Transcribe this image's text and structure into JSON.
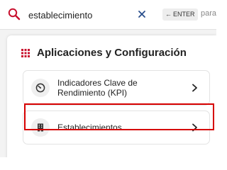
{
  "search": {
    "value": "establecimiento",
    "enter_label": "ENTER",
    "enter_arrow": "←",
    "hint_suffix": "para"
  },
  "section": {
    "title": "Aplicaciones y Configuración"
  },
  "items": [
    {
      "label": "Indicadores Clave de Rendimiento (KPI)",
      "icon": "gauge-icon"
    },
    {
      "label": "Establecimientos",
      "icon": "building-icon"
    }
  ],
  "colors": {
    "accent": "#d60000",
    "icon_red": "#c8102e",
    "panel_bg": "#f3f3f3"
  }
}
